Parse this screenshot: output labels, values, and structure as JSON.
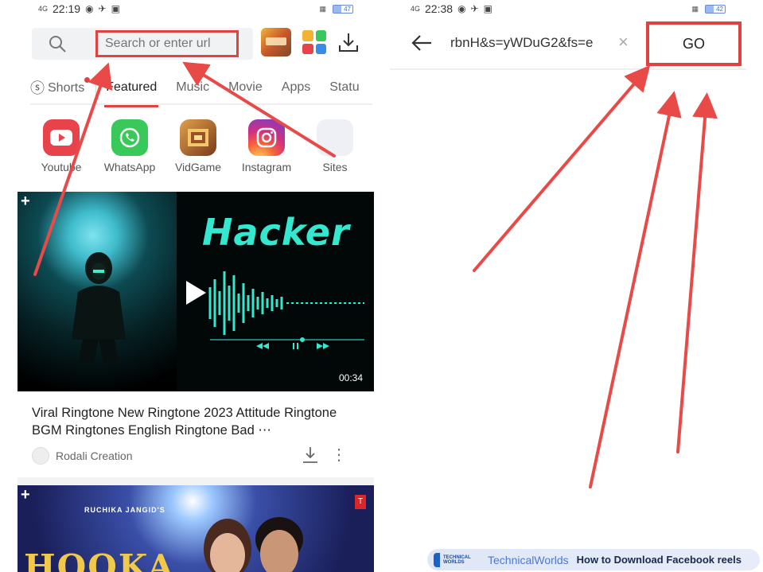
{
  "left": {
    "status": {
      "signal": "4G",
      "time": "22:19",
      "battery": "47"
    },
    "search": {
      "placeholder": "Search or enter url"
    },
    "tabs": [
      {
        "label": "Shorts"
      },
      {
        "label": "Featured"
      },
      {
        "label": "Music"
      },
      {
        "label": "Movie"
      },
      {
        "label": "Apps"
      },
      {
        "label": "Statu"
      }
    ],
    "shortcuts": [
      {
        "label": "Youtube",
        "icon": "youtube-icon"
      },
      {
        "label": "WhatsApp",
        "icon": "whatsapp-icon"
      },
      {
        "label": "VidGame",
        "icon": "vidgame-icon"
      },
      {
        "label": "Instagram",
        "icon": "instagram-icon"
      },
      {
        "label": "Sites",
        "icon": "sites-icon"
      }
    ],
    "video1": {
      "overlay_title": "Hacker",
      "duration": "00:34",
      "plus": "+",
      "title": "Viral Ringtone New Ringtone 2023 Attitude Ringtone BGM Ringtones English Ringtone Bad ⋯",
      "channel": "Rodali Creation"
    },
    "video2": {
      "plus": "+",
      "artist": "RUCHIKA JANGID'S",
      "big_text": "HOOKA"
    }
  },
  "right": {
    "status": {
      "signal": "4G",
      "time": "22:38",
      "battery": "42"
    },
    "url_text": "rbnH&s=yWDuG2&fs=e",
    "clear": "×",
    "go_label": "GO"
  },
  "watermark": {
    "logo_text": "TECHNICAL WORLDS",
    "brand": "TechnicalWorlds",
    "title": "How to Download Facebook reels"
  },
  "colors": {
    "highlight_red": "#e0433f",
    "hacker_cyan": "#34e8d0",
    "watermark_blue": "#4a78d8"
  }
}
